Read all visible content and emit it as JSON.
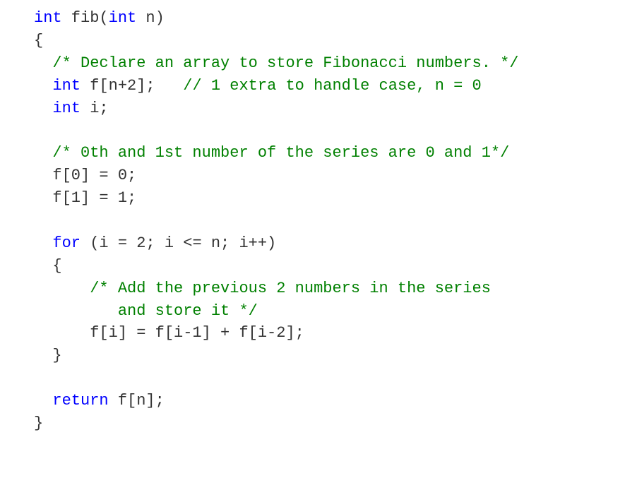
{
  "code": {
    "l1a": "int",
    "l1b": " fib(",
    "l1c": "int",
    "l1d": " n)",
    "l2": "{",
    "l3": "  /* Declare an array to store Fibonacci numbers. */",
    "l4a": "  ",
    "l4b": "int",
    "l4c": " f[n+2];   ",
    "l4d": "// 1 extra to handle case, n = 0",
    "l5a": "  ",
    "l5b": "int",
    "l5c": " i;",
    "l6": " ",
    "l7": "  /* 0th and 1st number of the series are 0 and 1*/",
    "l8": "  f[0] = 0;",
    "l9": "  f[1] = 1;",
    "l10": " ",
    "l11a": "  ",
    "l11b": "for",
    "l11c": " (i = 2; i <= n; i++)",
    "l12": "  {",
    "l13": "      /* Add the previous 2 numbers in the series",
    "l14": "         and store it */",
    "l15": "      f[i] = f[i-1] + f[i-2];",
    "l16": "  }",
    "l17": " ",
    "l18a": "  ",
    "l18b": "return",
    "l18c": " f[n];",
    "l19": "}"
  }
}
